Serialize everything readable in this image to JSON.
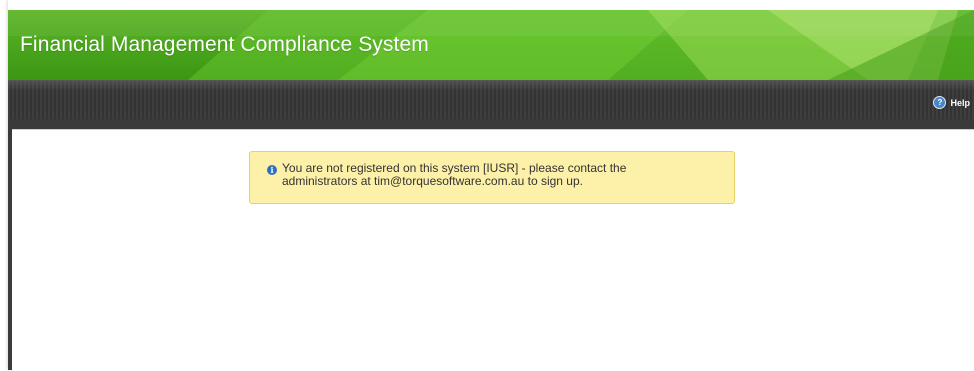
{
  "app": {
    "title": "Financial Management Compliance System"
  },
  "toolbar": {
    "help_label": "Help",
    "help_icon": "help-circle-icon"
  },
  "alert": {
    "type": "info",
    "icon": "info-icon",
    "line1": "You are not registered on this system [IUSR] - please contact the",
    "line2": "administrators at tim@torquesoftware.com.au to sign up."
  },
  "colors": {
    "header_green": "#49a51c",
    "toolbar_dark": "#3a3a3a",
    "alert_background": "#fdf0a8",
    "alert_border": "#e6d363",
    "info_blue": "#2f6fc2"
  }
}
